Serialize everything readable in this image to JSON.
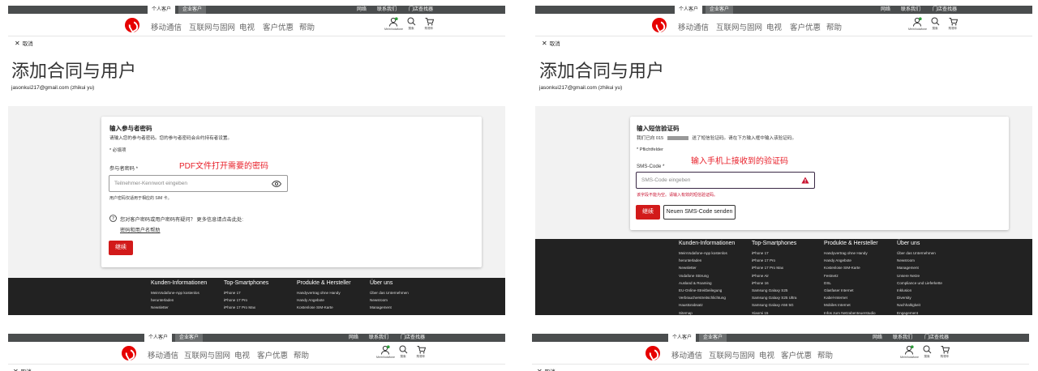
{
  "header": {
    "seg_personal": "个人客户",
    "seg_business": "企业客户",
    "util_network": "网络",
    "util_contact": "联系我们",
    "util_store": "门店查找器",
    "nav": [
      "移动通信",
      "互联网与固网",
      "电视",
      "客户优惠",
      "帮助"
    ],
    "icon_account": "MeinVodafone",
    "icon_search": "搜索",
    "icon_cart": "购物车"
  },
  "page": {
    "cancel": "取消",
    "title": "添加合同与用户",
    "account": "jasonkui217@gmail.com (zhikui yu)"
  },
  "password_card": {
    "heading": "输入参与者密码",
    "desc": "请输入您的参与者密码。您的参与者密码会合约持有者设置。",
    "required": "* 必填项",
    "field_label": "参与者密码 *",
    "placeholder": "Teilnehmer-Kennwort eingeben",
    "hint": "用户密码仅适用于相应的 SIM 卡。",
    "help_text": "您对客户密码或用户密码有疑问？ 更多信息请点击此处:",
    "help_link": "密码和用户名帮助",
    "submit": "继续",
    "annotation": "PDF文件打开需要的密码"
  },
  "sms_card": {
    "heading": "输入短信验证码",
    "desc_a": "我们已向 015",
    "desc_b": "送了短信验证码。请在下方输入框中输入该验证码。",
    "required": "* Pflichtfelder",
    "field_label": "SMS-Code *",
    "placeholder": "SMS-Code eingeben",
    "error": "该字段不能为空。请输入有效的短信验证码。",
    "submit": "继续",
    "resend": "Neuen SMS-Code senden",
    "annotation": "输入手机上接收到的验证码"
  },
  "footer": {
    "columns": [
      {
        "title": "Kunden-Informationen",
        "items": [
          "MeinVodafone-App kostenlos",
          "herunterladen",
          "Newsletter",
          "Vodafone Störung",
          "Ausland & Roaming",
          "EU-Online-Streitbeilegung",
          "Verbraucherstreitschlichtung",
          "Haustürabsatz",
          "Sitemap"
        ]
      },
      {
        "title": "Top-Smartphones",
        "items": [
          "iPhone 17",
          "iPhone 17 Pro",
          "iPhone 17 Pro Max",
          "iPhone Air",
          "iPhone 16",
          "Samsung Galaxy S25",
          "Samsung Galaxy S25 Ultra",
          "Samsung Galaxy A56 5G",
          "Xiaomi 15"
        ]
      },
      {
        "title": "Produkte & Hersteller",
        "items": [
          "Handyvertrag ohne Handy",
          "Handy Angebote",
          "Kostenlose SIM-Karte",
          "Festnetz",
          "DSL",
          "Glasfaser Internet",
          "Kabel-Internet",
          "Mobiles Internet",
          "Infos zum Netzabenteuerstudio"
        ]
      },
      {
        "title": "Über uns",
        "items": [
          "Über das Unternehmen",
          "Newsroom",
          "Management",
          "Unsere Netze",
          "Compliance und Lieferkette",
          "Inklusion",
          "Diversity",
          "Nachhaltigkeit",
          "Engagement"
        ]
      }
    ]
  },
  "colors": {
    "brand": "#e60000",
    "button": "#d21a1a",
    "annotation": "#e8202a",
    "topbar": "#4a4d4e",
    "footer": "#222222"
  }
}
